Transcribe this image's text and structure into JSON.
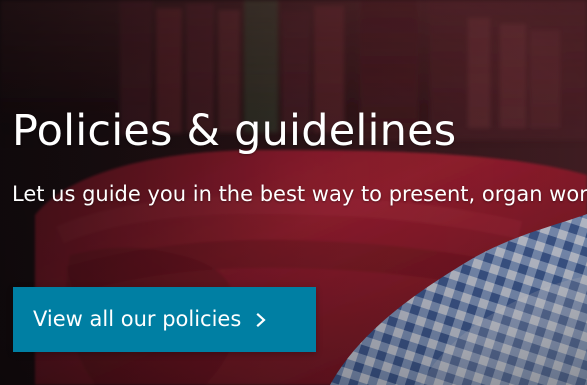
{
  "hero": {
    "title": "Policies & guidelines",
    "subtitle": "Let us guide you in the best way to present, organ work",
    "cta": {
      "label": "View all our policies",
      "icon": "chevron-right-icon"
    }
  },
  "colors": {
    "cta_background": "#007fa3",
    "text": "#ffffff"
  }
}
